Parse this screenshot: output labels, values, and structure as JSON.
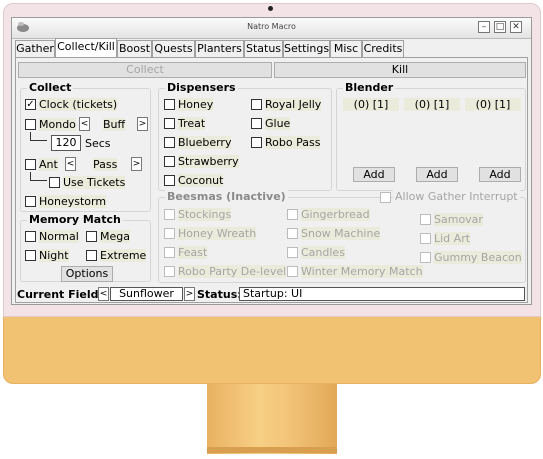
{
  "window": {
    "title": "Natro Macro"
  },
  "tabs": [
    {
      "label": "Gather"
    },
    {
      "label": "Collect/Kill",
      "active": true
    },
    {
      "label": "Boost"
    },
    {
      "label": "Quests"
    },
    {
      "label": "Planters"
    },
    {
      "label": "Status"
    },
    {
      "label": "Settings"
    },
    {
      "label": "Misc"
    },
    {
      "label": "Credits"
    }
  ],
  "subtabs": {
    "collect": "Collect",
    "kill": "Kill"
  },
  "collect": {
    "title": "Collect",
    "clock": {
      "label": "Clock (tickets)",
      "checked": true
    },
    "mondo": {
      "label": "Mondo",
      "checked": false,
      "option": "Buff",
      "left": "<",
      "right": ">"
    },
    "secs": {
      "value": "120",
      "label": "Secs"
    },
    "ant": {
      "label": "Ant",
      "checked": false,
      "option": "Pass",
      "left": "<",
      "right": ">"
    },
    "use_tickets": {
      "label": "Use Tickets",
      "checked": false
    },
    "honeystorm": {
      "label": "Honeystorm",
      "checked": false
    }
  },
  "memory_match": {
    "title": "Memory Match",
    "normal": "Normal",
    "mega": "Mega",
    "night": "Night",
    "extreme": "Extreme",
    "options": "Options"
  },
  "dispensers": {
    "title": "Dispensers",
    "col1": [
      "Honey",
      "Treat",
      "Blueberry",
      "Strawberry",
      "Coconut"
    ],
    "col2": [
      "Royal Jelly",
      "Glue",
      "Robo Pass"
    ]
  },
  "blender": {
    "title": "Blender",
    "slots": [
      "(0) [1]",
      "(0) [1]",
      "(0) [1]"
    ],
    "add": "Add"
  },
  "beesmas": {
    "title": "Beesmas (Inactive)",
    "allow_gather": "Allow Gather Interrupt",
    "col1": [
      "Stockings",
      "Honey Wreath",
      "Feast",
      "Robo Party De-level"
    ],
    "col2": [
      "Gingerbread",
      "Snow Machine",
      "Candles",
      "Winter Memory Match"
    ],
    "col3": [
      "Samovar",
      "Lid Art",
      "Gummy Beacon"
    ]
  },
  "status": {
    "field_label": "Current Field:",
    "field_left": "<",
    "field_value": "Sunflower",
    "field_right": ">",
    "status_label": "Status:",
    "status_value": "Startup: UI"
  },
  "colors": {
    "frame_pink": "#f4e3e6",
    "chin_orange": "#f2c273",
    "window_bg": "#f0f0f0"
  }
}
